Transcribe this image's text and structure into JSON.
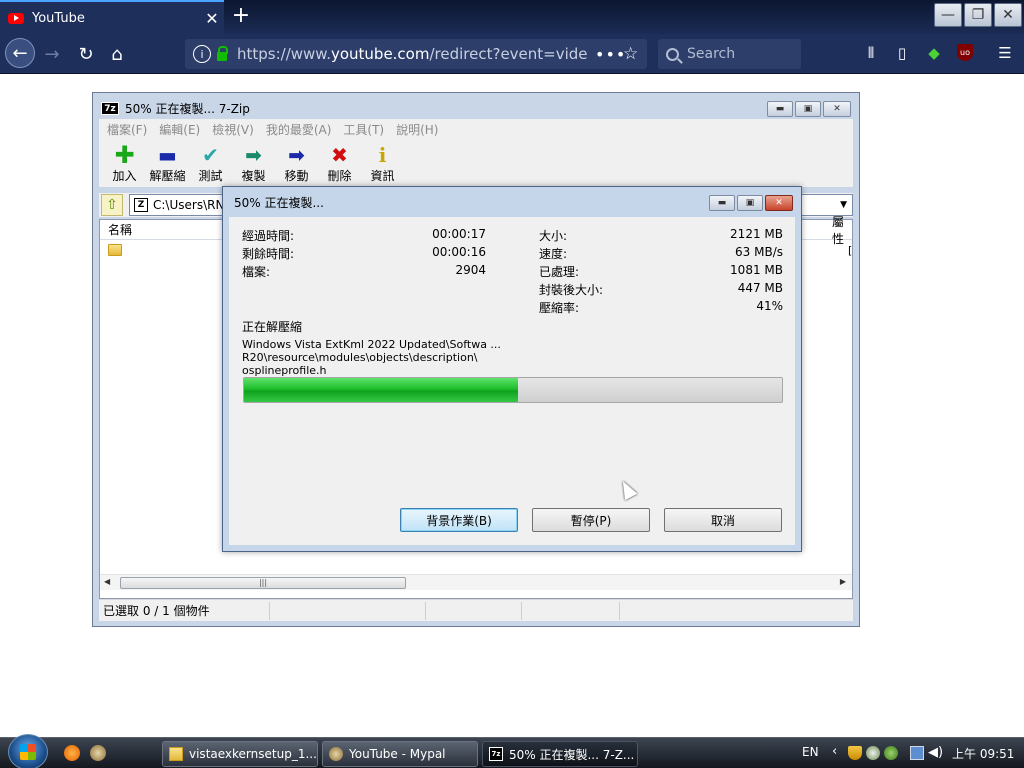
{
  "browser": {
    "tab_title": "YouTube",
    "url_prefix": "https://www.",
    "url_domain": "youtube.com",
    "url_path": "/redirect?event=video",
    "search_placeholder": "Search"
  },
  "zip_main": {
    "title": "50% 正在複製... 7-Zip",
    "menu": [
      "檔案(F)",
      "編輯(E)",
      "檢視(V)",
      "我的最愛(A)",
      "工具(T)",
      "說明(H)"
    ],
    "toolbar": [
      {
        "label": "加入",
        "icon": "add-icon",
        "color": "#1aa81a"
      },
      {
        "label": "解壓縮",
        "icon": "extract-icon",
        "color": "#1a2aa8"
      },
      {
        "label": "測試",
        "icon": "test-icon",
        "color": "#2aa8a8"
      },
      {
        "label": "複製",
        "icon": "copy-icon",
        "color": "#1a8a6a"
      },
      {
        "label": "移動",
        "icon": "move-icon",
        "color": "#1a2aa8"
      },
      {
        "label": "刪除",
        "icon": "delete-icon",
        "color": "#d01010"
      },
      {
        "label": "資訊",
        "icon": "info-icon",
        "color": "#c8a800"
      }
    ],
    "address": "C:\\Users\\RN",
    "column_name": "名稱",
    "column_right": "屬性",
    "status": "已選取 0 / 1 個物件"
  },
  "dialog": {
    "title": "50% 正在複製...",
    "elapsed_label": "經過時間:",
    "elapsed_value": "00:00:17",
    "remaining_label": "剩餘時間:",
    "remaining_value": "00:00:16",
    "files_label": "檔案:",
    "files_value": "2904",
    "size_label": "大小:",
    "size_value": "2121 MB",
    "speed_label": "速度:",
    "speed_value": "63 MB/s",
    "processed_label": "已處理:",
    "processed_value": "1081 MB",
    "packed_label": "封裝後大小:",
    "packed_value": "447 MB",
    "ratio_label": "壓縮率:",
    "ratio_value": "41%",
    "status": "正在解壓縮",
    "path_line1": "Windows Vista ExtKml 2022 Updated\\Softwa ... R20\\resource\\modules\\objects\\description\\",
    "path_line2": "osplineprofile.h",
    "progress": 0.51,
    "btn_background": "背景作業(B)",
    "btn_pause": "暫停(P)",
    "btn_cancel": "取消"
  },
  "taskbar": {
    "tasks": [
      {
        "label": "vistaexkernsetup_1..."
      },
      {
        "label": "YouTube - Mypal"
      },
      {
        "label": "50% 正在複製... 7-Z..."
      }
    ],
    "lang": "EN",
    "time": "上午 09:51"
  }
}
